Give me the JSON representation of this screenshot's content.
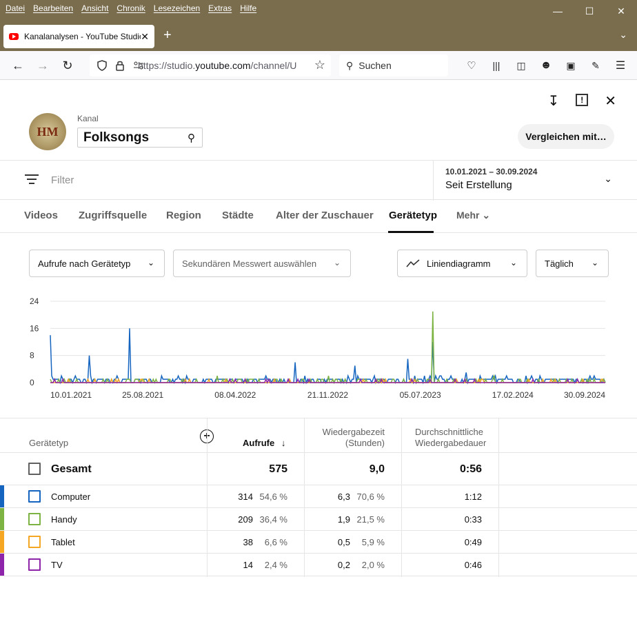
{
  "browser": {
    "menu": [
      "Datei",
      "Bearbeiten",
      "Ansicht",
      "Chronik",
      "Lesezeichen",
      "Extras",
      "Hilfe"
    ],
    "tab_title": "Kanalanalysen - YouTube Studio",
    "url_prefix": "https://studio.",
    "url_domain": "youtube.com",
    "url_rest": "/channel/U",
    "search_placeholder": "Suchen"
  },
  "header": {
    "avatar_text": "HM",
    "kanal_label": "Kanal",
    "kanal_value": "Folksongs",
    "compare_label": "Vergleichen mit…"
  },
  "filter": {
    "placeholder": "Filter",
    "date_range": "10.01.2021 – 30.09.2024",
    "date_label": "Seit Erstellung"
  },
  "tabs": [
    "Videos",
    "Zugriffsquelle",
    "Region",
    "Städte",
    "Alter der Zuschauer",
    "Gerätetyp",
    "Mehr"
  ],
  "active_tab": "Gerätetyp",
  "controls": {
    "metric": "Aufrufe nach Gerätetyp",
    "secondary": "Sekundären Messwert auswählen",
    "chart_type": "Liniendiagramm",
    "interval": "Täglich"
  },
  "chart_data": {
    "type": "line",
    "ylim": [
      0,
      24
    ],
    "yticks": [
      "0",
      "8",
      "16",
      "24"
    ],
    "xticks": [
      "10.01.2021",
      "25.08.2021",
      "08.04.2022",
      "21.11.2022",
      "05.07.2023",
      "17.02.2024",
      "30.09.2024"
    ],
    "series": [
      {
        "name": "Computer",
        "color": "#1565c0",
        "peaks": [
          [
            0.0,
            14
          ],
          [
            0.07,
            8
          ],
          [
            0.143,
            16
          ],
          [
            0.44,
            6
          ],
          [
            0.55,
            5
          ],
          [
            0.645,
            7
          ],
          [
            0.69,
            12
          ],
          [
            0.75,
            3
          ],
          [
            0.98,
            2
          ]
        ]
      },
      {
        "name": "Handy",
        "color": "#7cb342",
        "peaks": [
          [
            0.69,
            21
          ],
          [
            0.3,
            2
          ],
          [
            0.5,
            2
          ],
          [
            0.8,
            2
          ]
        ]
      },
      {
        "name": "Tablet",
        "color": "#f5a623",
        "peaks": [
          [
            0.25,
            1
          ],
          [
            0.6,
            1
          ]
        ]
      },
      {
        "name": "TV",
        "color": "#8e24aa",
        "peaks": [
          [
            0.35,
            1
          ],
          [
            0.95,
            1
          ]
        ]
      }
    ]
  },
  "table": {
    "headers": {
      "dim": "Gerätetyp",
      "views": "Aufrufe",
      "watch1": "Wiedergabezeit",
      "watch2": "(Stunden)",
      "avg1": "Durchschnittliche",
      "avg2": "Wiedergabedauer"
    },
    "total": {
      "label": "Gesamt",
      "views": "575",
      "watch": "9,0",
      "avg": "0:56"
    },
    "rows": [
      {
        "label": "Computer",
        "views": "314",
        "views_pct": "54,6 %",
        "watch": "6,3",
        "watch_pct": "70,6 %",
        "avg": "1:12",
        "color": "#1565c0"
      },
      {
        "label": "Handy",
        "views": "209",
        "views_pct": "36,4 %",
        "watch": "1,9",
        "watch_pct": "21,5 %",
        "avg": "0:33",
        "color": "#7cb342"
      },
      {
        "label": "Tablet",
        "views": "38",
        "views_pct": "6,6 %",
        "watch": "0,5",
        "watch_pct": "5,9 %",
        "avg": "0:49",
        "color": "#f5a623"
      },
      {
        "label": "TV",
        "views": "14",
        "views_pct": "2,4 %",
        "watch": "0,2",
        "watch_pct": "2,0 %",
        "avg": "0:46",
        "color": "#8e24aa"
      }
    ]
  }
}
